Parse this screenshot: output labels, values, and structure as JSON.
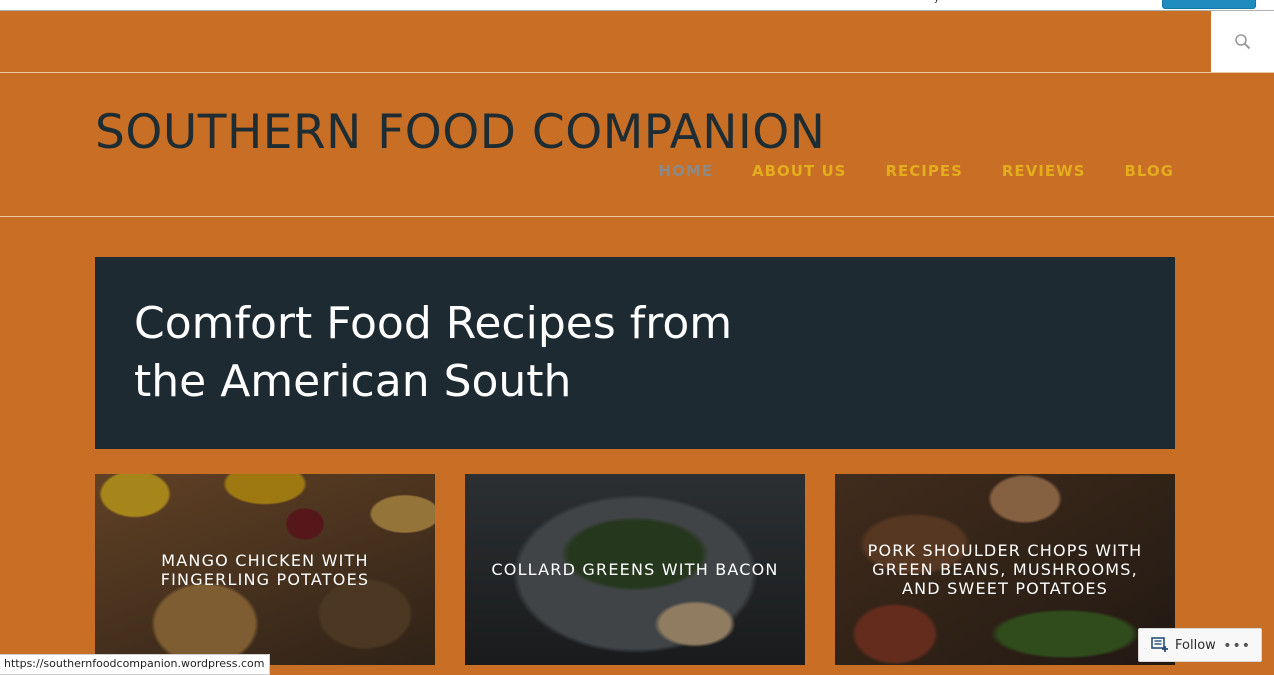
{
  "site": {
    "title": "SOUTHERN FOOD COMPANION",
    "nav": [
      {
        "label": "HOME",
        "active": true
      },
      {
        "label": "ABOUT US",
        "active": false
      },
      {
        "label": "RECIPES",
        "active": false
      },
      {
        "label": "REVIEWS",
        "active": false
      },
      {
        "label": "BLOG",
        "active": false
      }
    ]
  },
  "hero": {
    "title": "Comfort Food Recipes from the American South"
  },
  "cards": [
    {
      "title": "MANGO CHICKEN WITH FINGERLING POTATOES"
    },
    {
      "title": "COLLARD GREENS WITH BACON"
    },
    {
      "title": "PORK SHOULDER CHOPS WITH GREEN BEANS, MUSHROOMS, AND SWEET POTATOES"
    }
  ],
  "status_bar": {
    "url": "https://southernfoodcompanion.wordpress.com"
  },
  "follow_widget": {
    "label": "Follow",
    "more": "•••"
  },
  "icons": {
    "search": "search-icon",
    "follow": "reader-follow-icon"
  },
  "colors": {
    "background": "#c86e25",
    "hero_background": "#1d2a31",
    "nav_link": "#e3ad1e",
    "nav_active": "#8a8a8a",
    "title_text": "#1e2d33"
  }
}
